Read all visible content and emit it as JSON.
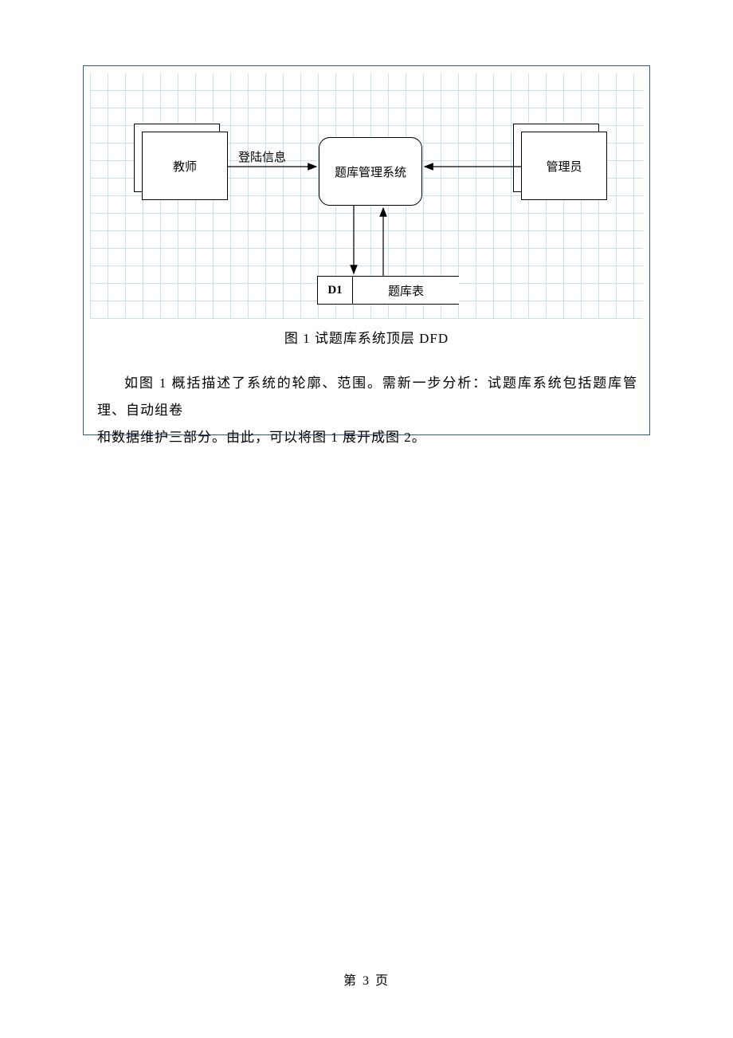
{
  "diagram": {
    "entities": {
      "teacher": "教师",
      "admin": "管理员"
    },
    "process": "题库管理系统",
    "datastore": {
      "id": "D1",
      "label": "题库表"
    },
    "flow_labels": {
      "login_info": "登陆信息"
    }
  },
  "caption": "图 1 试题库系统顶层 DFD",
  "body_text_line1": "如图 1 概括描述了系统的轮廓、范围。需新一步分析：试题库系统包括题库管理、自动组卷",
  "body_text_line2": "和数据维护三部分。由此，可以将图 1 展开成图 2。",
  "footer": "第 3 页"
}
